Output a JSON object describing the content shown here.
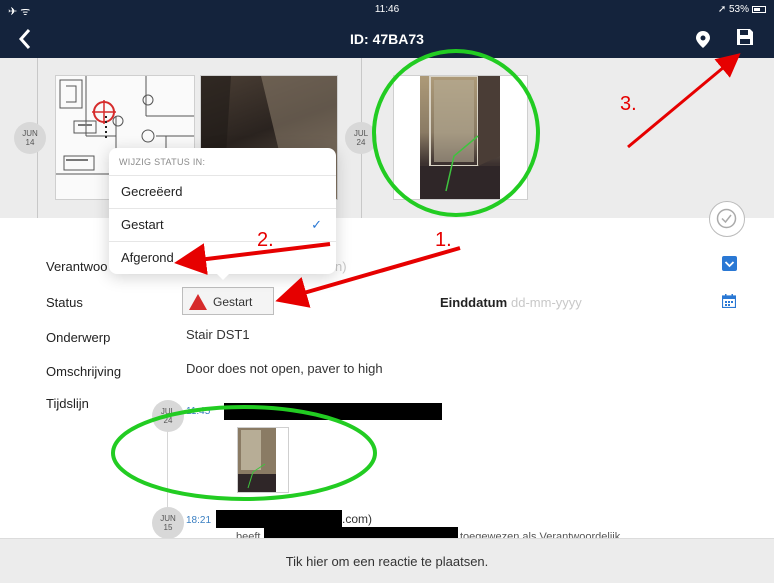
{
  "status_bar": {
    "signal": "✈ ᯤ",
    "time": "11:46",
    "battery": "➚ 53%"
  },
  "nav": {
    "back_icon": "chevron-left",
    "title": "ID: 47BA73",
    "pin_icon": "location-pin",
    "save_icon": "floppy-disk"
  },
  "gallery": {
    "items": [
      {
        "month": "JUN",
        "day": "14"
      },
      {
        "month": "JUL",
        "day": "24"
      }
    ]
  },
  "popover": {
    "heading": "WIJZIG STATUS IN:",
    "options": [
      {
        "label": "Gecreëerd",
        "selected": false
      },
      {
        "label": "Gestart",
        "selected": true
      },
      {
        "label": "Afgerond",
        "selected": false
      }
    ]
  },
  "form": {
    "responsible_label": "Verantwoo",
    "responsible_value": "n)",
    "status_label": "Status",
    "status_value": "Gestart",
    "end_date_label": "Einddatum",
    "end_date_placeholder": "dd-mm-yyyy",
    "subject_label": "Onderwerp",
    "subject_value": "Stair DST1",
    "description_label": "Omschrijving",
    "description_value": "Door does not open, paver to high",
    "timeline_label": "Tijdslijn"
  },
  "timeline": [
    {
      "month": "JUL",
      "day": "24",
      "time": "11:45"
    },
    {
      "month": "JUN",
      "day": "15",
      "time": "18:21",
      "text_tail": ".com)",
      "line_prefix": "beeft",
      "line_suffix": "toegewezen als Verantwoordelijk"
    }
  ],
  "annotations": {
    "n1": "1.",
    "n2": "2.",
    "n3": "3."
  },
  "footer": {
    "comment_prompt": "Tik hier om een reactie te plaatsen."
  },
  "colors": {
    "navbar": "#14233c",
    "accent": "#2a78d4",
    "status_red": "#d62b2b",
    "annotation_red": "#e60000",
    "highlight_green": "#22cc22"
  }
}
